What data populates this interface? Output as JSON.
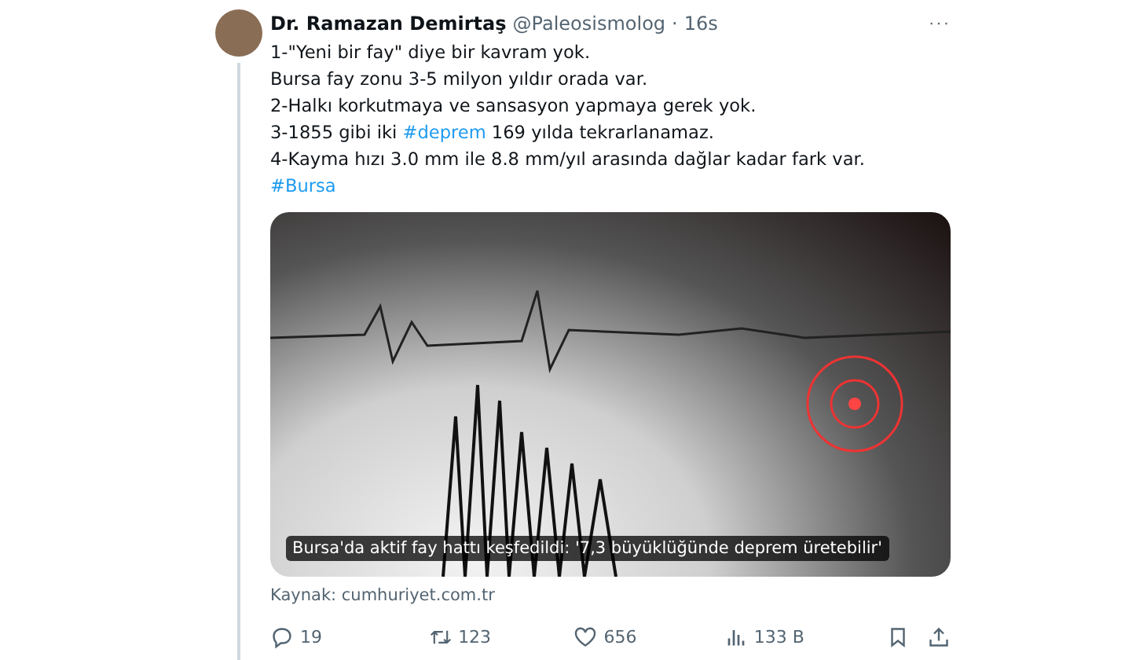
{
  "tweet": {
    "author_name": "Dr. Ramazan Demirtaş",
    "handle": "@Paleosismolog",
    "separator": "·",
    "time": "16s",
    "more": "···",
    "lines": [
      {
        "segments": [
          {
            "kind": "text",
            "text": "1-\"Yeni bir fay\" diye bir kavram yok."
          }
        ]
      },
      {
        "segments": [
          {
            "kind": "text",
            "text": "Bursa fay zonu 3-5 milyon yıldır orada var."
          }
        ]
      },
      {
        "segments": [
          {
            "kind": "text",
            "text": "2-Halkı korkutmaya ve sansasyon yapmaya gerek yok."
          }
        ]
      },
      {
        "segments": [
          {
            "kind": "text",
            "text": "3-1855 gibi iki "
          },
          {
            "kind": "hashtag",
            "text": "#deprem"
          },
          {
            "kind": "text",
            "text": " 169 yılda tekrarlanamaz."
          }
        ]
      },
      {
        "segments": [
          {
            "kind": "text",
            "text": "4-Kayma hızı 3.0 mm ile 8.8 mm/yıl arasında dağlar kadar fark var."
          }
        ]
      },
      {
        "segments": [
          {
            "kind": "hashtag",
            "text": "#Bursa"
          }
        ]
      }
    ],
    "card": {
      "caption": "Bursa'da aktif fay hattı keşfedildi: '7,3 büyüklüğünde deprem üretebilir'",
      "source": "Kaynak: cumhuriyet.com.tr"
    },
    "actions": [
      {
        "kind": "reply",
        "count": "19"
      },
      {
        "kind": "retweet",
        "count": "123"
      },
      {
        "kind": "like",
        "count": "656"
      },
      {
        "kind": "views",
        "count": "133 B"
      },
      {
        "kind": "bookmark"
      },
      {
        "kind": "share"
      }
    ]
  }
}
